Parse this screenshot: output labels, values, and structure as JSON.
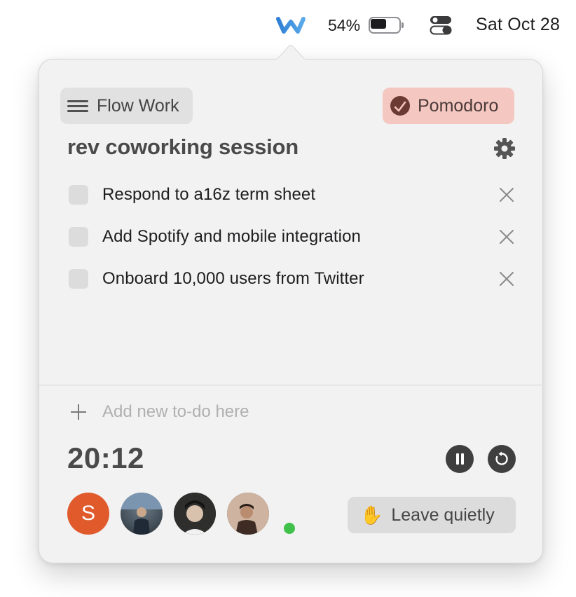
{
  "menubar": {
    "battery_percent": "54%",
    "battery_level": 0.54,
    "date": "Sat Oct 28",
    "app_icon": "flow-w-logo",
    "control_center_icon": "control-center-icon"
  },
  "popover": {
    "session_type_label": "Flow Work",
    "mode_label": "Pomodoro",
    "session_title": "rev coworking session",
    "todos": [
      {
        "text": "Respond to a16z term sheet",
        "done": false
      },
      {
        "text": "Add Spotify and mobile integration",
        "done": false
      },
      {
        "text": "Onboard 10,000 users from Twitter",
        "done": false
      }
    ],
    "add_todo_placeholder": "Add new to-do here",
    "timer": "20:12",
    "participants": [
      {
        "initial": "S",
        "color": "#e05a2b"
      },
      {
        "initial": "",
        "online": false
      },
      {
        "initial": "",
        "online": false
      },
      {
        "initial": "",
        "online": true
      }
    ],
    "leave_label": "Leave quietly"
  },
  "colors": {
    "popover_bg": "#f2f2f2",
    "pomodoro_bg": "#f4c7c1",
    "online": "#3fc14b",
    "logo_blue": "#3b8fd9"
  }
}
